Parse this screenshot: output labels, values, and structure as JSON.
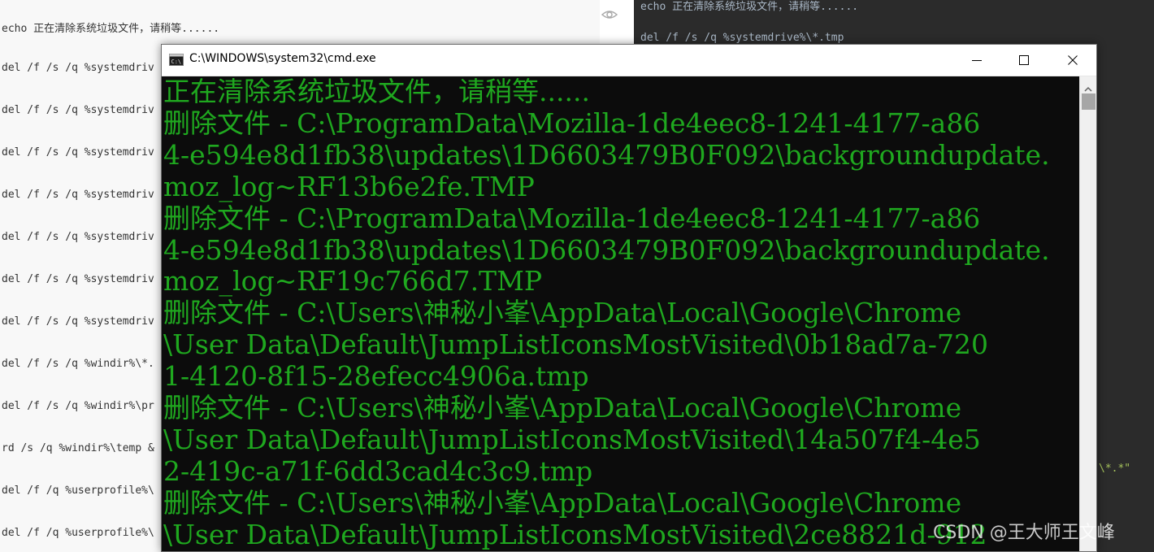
{
  "editor_left": {
    "lines": [
      "echo 正在清除系统垃圾文件，请稍等......",
      "del /f /s /q %systemdriv",
      "del /f /s /q %systemdriv",
      "del /f /s /q %systemdriv",
      "del /f /s /q %systemdriv",
      "del /f /s /q %systemdriv",
      "del /f /s /q %systemdriv",
      "del /f /s /q %systemdriv",
      "del /f /s /q %windir%\\*.",
      "del /f /s /q %windir%\\pr",
      "rd /s /q %windir%\\temp &",
      "del /f /q %userprofile%\\",
      "del /f /q %userprofile%\\"
    ]
  },
  "editor_right": {
    "lines": [
      "echo 正在清除系统垃圾文件，请稍等......",
      "del /f /s /q %systemdrive%\\*.tmp"
    ],
    "fragment": "\\*.*\""
  },
  "cmd_window": {
    "title": "C:\\WINDOWS\\system32\\cmd.exe",
    "console_lines": [
      "正在清除系统垃圾文件，请稍等......",
      "删除文件 - C:\\ProgramData\\Mozilla-1de4eec8-1241-4177-a86",
      "4-e594e8d1fb38\\updates\\1D6603479B0F092\\backgroundupdate.",
      "moz_log~RF13b6e2fe.TMP",
      "删除文件 - C:\\ProgramData\\Mozilla-1de4eec8-1241-4177-a86",
      "4-e594e8d1fb38\\updates\\1D6603479B0F092\\backgroundupdate.",
      "moz_log~RF19c766d7.TMP",
      "删除文件 - C:\\Users\\神秘小峯\\AppData\\Local\\Google\\Chrome",
      "\\User Data\\Default\\JumpListIconsMostVisited\\0b18ad7a-720",
      "1-4120-8f15-28efecc4906a.tmp",
      "删除文件 - C:\\Users\\神秘小峯\\AppData\\Local\\Google\\Chrome",
      "\\User Data\\Default\\JumpListIconsMostVisited\\14a507f4-4e5",
      "2-419c-a71f-6dd3cad4c3c9.tmp",
      "删除文件 - C:\\Users\\神秘小峯\\AppData\\Local\\Google\\Chrome",
      "\\User Data\\Default\\JumpListIconsMostVisited\\2ce8821d-912"
    ],
    "text_color": "#1fa81f",
    "background": "#0c0c0c"
  },
  "watermark": "CSDN @王大师王文峰",
  "icons": {
    "eye": "eye-icon",
    "app": "cmd-app-icon",
    "minimize": "minimize-icon",
    "maximize": "maximize-icon",
    "close": "close-icon"
  }
}
